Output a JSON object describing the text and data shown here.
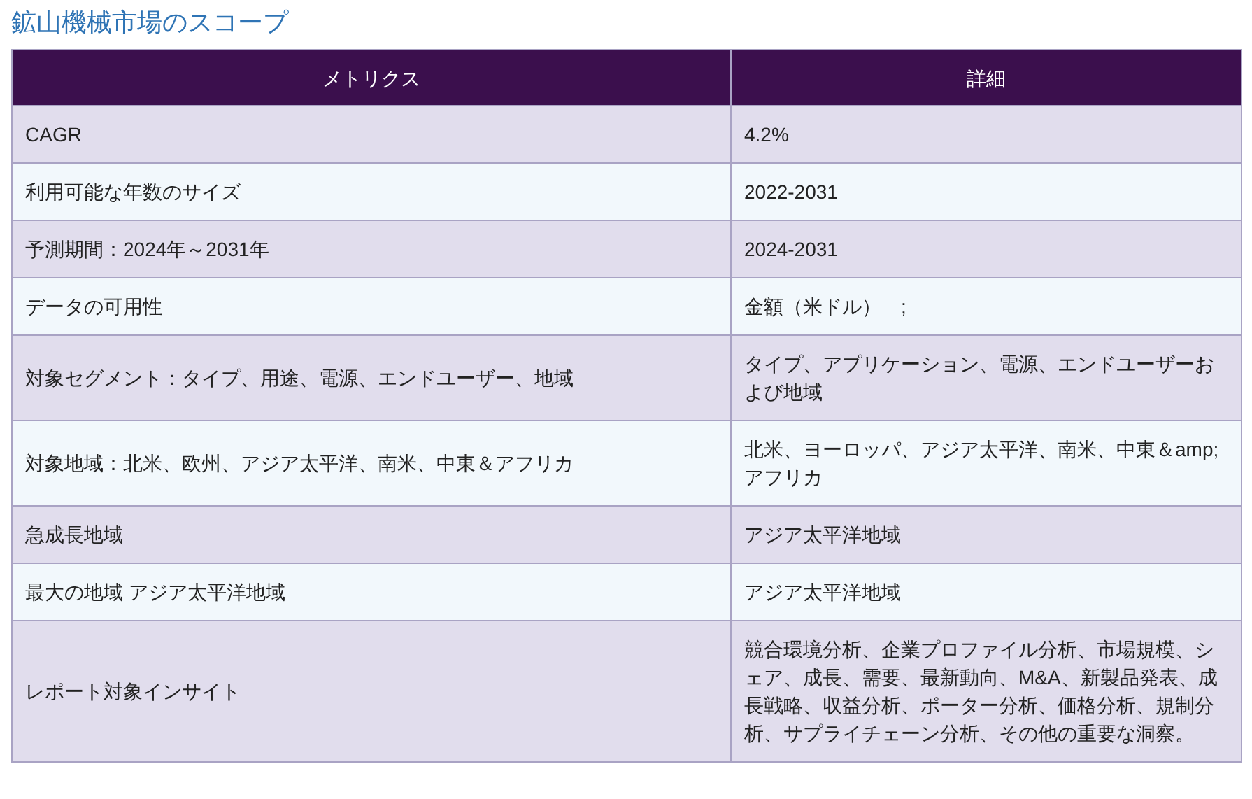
{
  "title": "鉱山機械市場のスコープ",
  "table": {
    "columns": [
      "メトリクス",
      "詳細"
    ],
    "rows": [
      [
        "CAGR",
        "4.2%"
      ],
      [
        "利用可能な年数のサイズ",
        "2022-2031"
      ],
      [
        "予測期間：2024年～2031年",
        "2024-2031"
      ],
      [
        "データの可用性",
        "金額（米ドル）　;"
      ],
      [
        "対象セグメント：タイプ、用途、電源、エンドユーザー、地域",
        "タイプ、アプリケーション、電源、エンドユーザーおよび地域"
      ],
      [
        "対象地域：北米、欧州、アジア太平洋、南米、中東＆アフリカ",
        "北米、ヨーロッパ、アジア太平洋、南米、中東＆amp;アフリカ"
      ],
      [
        "急成長地域",
        "アジア太平洋地域"
      ],
      [
        "最大の地域 アジア太平洋地域",
        "アジア太平洋地域"
      ],
      [
        "レポート対象インサイト",
        "競合環境分析、企業プロファイル分析、市場規模、シェア、成長、需要、最新動向、M&A、新製品発表、成長戦略、収益分析、ポーター分析、価格分析、規制分析、サプライチェーン分析、その他の重要な洞察。"
      ]
    ]
  }
}
